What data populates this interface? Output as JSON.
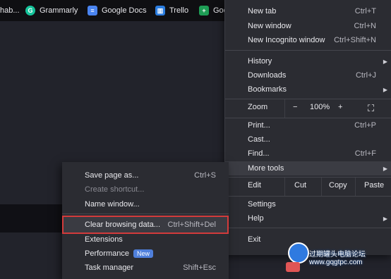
{
  "bookmarks": [
    {
      "label": "hab..."
    },
    {
      "label": "Grammarly",
      "icon": "grammarly-icon"
    },
    {
      "label": "Google Docs",
      "icon": "docs-icon"
    },
    {
      "label": "Trello",
      "icon": "trello-icon"
    },
    {
      "label": "Goo",
      "icon": "sheets-icon"
    }
  ],
  "main_menu": {
    "new_tab": {
      "label": "New tab",
      "shortcut": "Ctrl+T"
    },
    "new_window": {
      "label": "New window",
      "shortcut": "Ctrl+N"
    },
    "incognito": {
      "label": "New Incognito window",
      "shortcut": "Ctrl+Shift+N"
    },
    "history": {
      "label": "History"
    },
    "downloads": {
      "label": "Downloads",
      "shortcut": "Ctrl+J"
    },
    "bookmarks": {
      "label": "Bookmarks"
    },
    "zoom": {
      "label": "Zoom",
      "minus": "−",
      "value": "100%",
      "plus": "+"
    },
    "print": {
      "label": "Print...",
      "shortcut": "Ctrl+P"
    },
    "cast": {
      "label": "Cast..."
    },
    "find": {
      "label": "Find...",
      "shortcut": "Ctrl+F"
    },
    "more_tools": {
      "label": "More tools"
    },
    "edit": {
      "label": "Edit",
      "cut": "Cut",
      "copy": "Copy",
      "paste": "Paste"
    },
    "settings": {
      "label": "Settings"
    },
    "help": {
      "label": "Help"
    },
    "exit": {
      "label": "Exit"
    }
  },
  "sub_menu": {
    "save_page": {
      "label": "Save page as...",
      "shortcut": "Ctrl+S"
    },
    "create_shortcut": {
      "label": "Create shortcut..."
    },
    "name_window": {
      "label": "Name window..."
    },
    "clear_data": {
      "label": "Clear browsing data...",
      "shortcut": "Ctrl+Shift+Del"
    },
    "extensions": {
      "label": "Extensions"
    },
    "performance": {
      "label": "Performance",
      "badge": "New"
    },
    "task_manager": {
      "label": "Task manager",
      "shortcut": "Shift+Esc"
    }
  },
  "watermark": {
    "line1": "过期罐头电脑论坛",
    "line2": "www.gqgtpc.com"
  }
}
